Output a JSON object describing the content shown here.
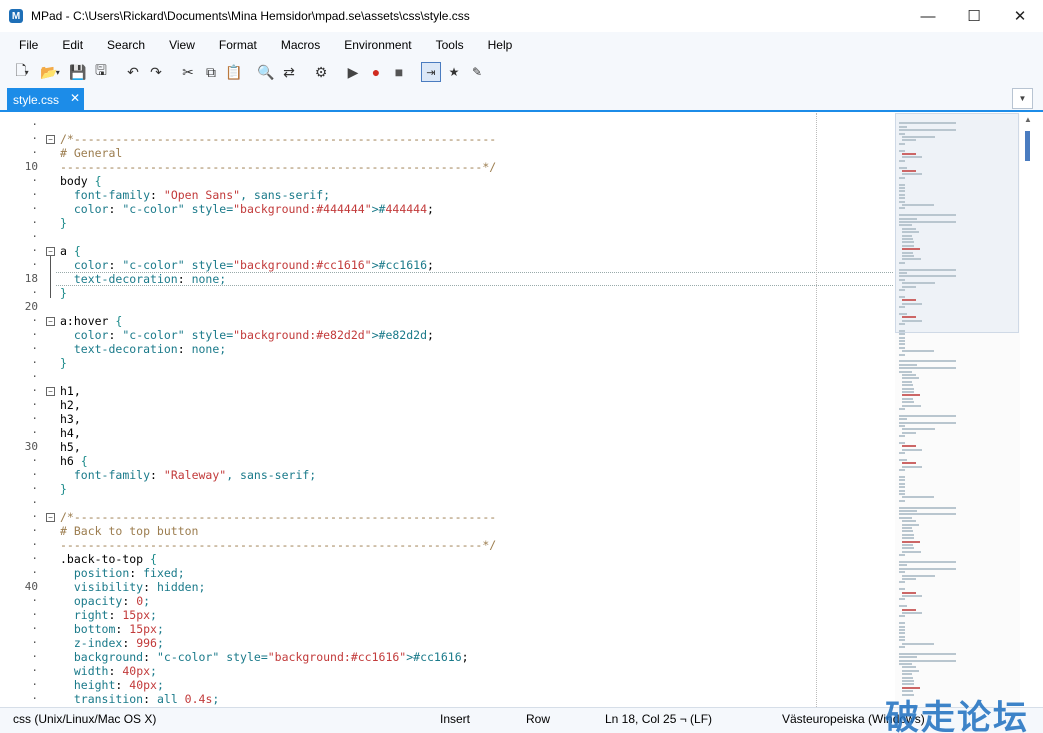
{
  "window": {
    "app_icon_letter": "M",
    "title": "MPad - C:\\Users\\Rickard\\Documents\\Mina Hemsidor\\mpad.se\\assets\\css\\style.css",
    "controls": {
      "minimize": "—",
      "maximize": "☐",
      "close": "✕"
    }
  },
  "menu": [
    "File",
    "Edit",
    "Search",
    "View",
    "Format",
    "Macros",
    "Environment",
    "Tools",
    "Help"
  ],
  "toolbar": {
    "icons": [
      "new-file-icon",
      "open-folder-icon",
      "save-icon",
      "save-all-icon",
      "undo-icon",
      "redo-icon",
      "cut-icon",
      "copy-icon",
      "paste-icon",
      "search-icon",
      "replace-icon",
      "settings-icon",
      "play-macro-icon",
      "record-macro-icon",
      "stop-macro-icon",
      "wrap-icon",
      "bookmark-icon",
      "spellcheck-icon"
    ],
    "active": "wrap-icon"
  },
  "tab": {
    "label": "style.css",
    "close": "✕"
  },
  "tab_dropdown": "▼",
  "colors": {
    "accent": "#1c8ce8",
    "color_444444": "#444444",
    "color_cc1616": "#cc1616",
    "color_e82d2d": "#e82d2d"
  },
  "gutter": {
    "line_numbers": [
      {
        "row": 3,
        "text": "10"
      },
      {
        "row": 11,
        "text": "18"
      },
      {
        "row": 13,
        "text": "20"
      },
      {
        "row": 23,
        "text": "30"
      },
      {
        "row": 33,
        "text": "40"
      }
    ]
  },
  "code": [
    "",
    "/*-------------------------------------------------------------",
    "# General",
    "-------------------------------------------------------------*/",
    "body {",
    "  font-family: \"Open Sans\", sans-serif;",
    "  color: #444444;",
    "}",
    "",
    "a {",
    "  color: #cc1616;",
    "  text-decoration: none;",
    "}",
    "",
    "a:hover {",
    "  color: #e82d2d;",
    "  text-decoration: none;",
    "}",
    "",
    "h1,",
    "h2,",
    "h3,",
    "h4,",
    "h5,",
    "h6 {",
    "  font-family: \"Raleway\", sans-serif;",
    "}",
    "",
    "/*-------------------------------------------------------------",
    "# Back to top button",
    "-------------------------------------------------------------*/",
    ".back-to-top {",
    "  position: fixed;",
    "  visibility: hidden;",
    "  opacity: 0;",
    "  right: 15px;",
    "  bottom: 15px;",
    "  z-index: 996;",
    "  background: #cc1616;",
    "  width: 40px;",
    "  height: 40px;",
    "  transition: all 0.4s;",
    "}"
  ],
  "status": {
    "language": "css (Unix/Linux/Mac OS X)",
    "mode": "Insert",
    "row_label": "Row",
    "position": "Ln 18, Col 25 ¬ (LF)",
    "encoding": "Västeuropeiska (Windows)"
  },
  "watermark": "破走论坛"
}
